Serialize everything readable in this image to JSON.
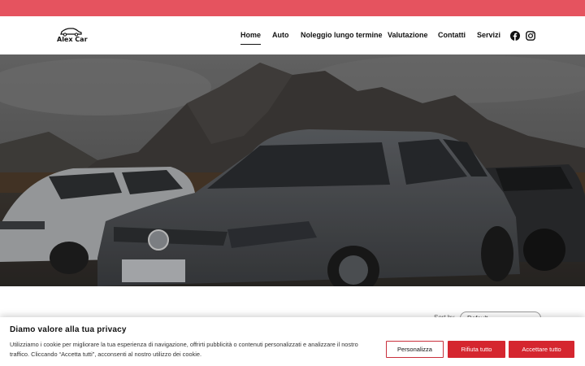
{
  "header": {
    "logo_text": "Alex Car",
    "nav": [
      {
        "label": "Home"
      },
      {
        "label": "Auto"
      },
      {
        "label": "Noleggio lungo termine"
      },
      {
        "label": "Valutazione"
      },
      {
        "label": "Contatti"
      },
      {
        "label": "Servizi"
      }
    ],
    "social_icons": [
      "facebook-icon",
      "instagram-icon"
    ]
  },
  "colors": {
    "topbar": "#e5535f",
    "button_red": "#d5262f"
  },
  "sort": {
    "label": "Sort by",
    "value": "Default"
  },
  "cookie_banner": {
    "title": "Diamo valore alla tua privacy",
    "text": "Utilizziamo i cookie per migliorare la tua esperienza di navigazione, offrirti pubblicità o contenuti personalizzati e analizzare il nostro traffico. Cliccando “Accetta tutti”, acconsenti al nostro utilizzo dei cookie.",
    "buttons": {
      "customize": "Personalizza",
      "reject": "Rifiuta tutto",
      "accept": "Accettare tutto"
    }
  }
}
